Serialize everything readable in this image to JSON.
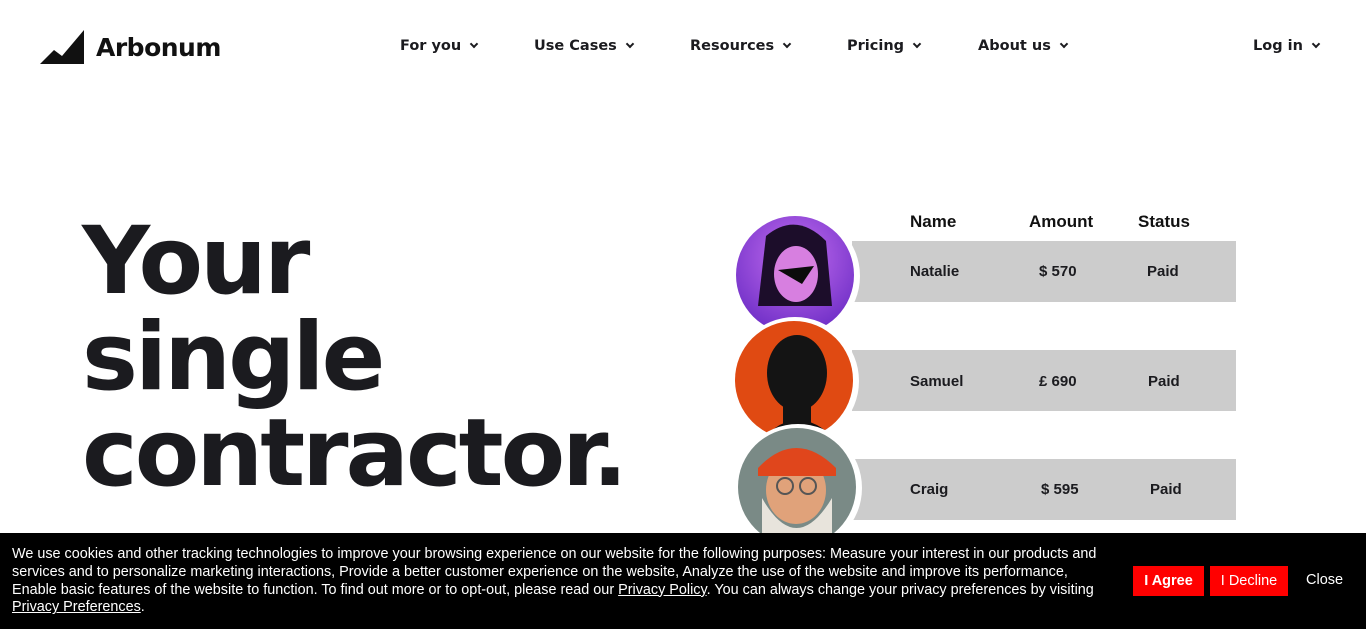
{
  "brand": {
    "name": "Arbonum",
    "logo_icon": "mountain-logo-icon"
  },
  "nav": {
    "items": [
      {
        "label": "For you",
        "icon": "chevron-down-icon"
      },
      {
        "label": "Use Cases",
        "icon": "chevron-down-icon"
      },
      {
        "label": "Resources",
        "icon": "chevron-down-icon"
      },
      {
        "label": "Pricing",
        "icon": "chevron-down-icon"
      },
      {
        "label": "About us",
        "icon": "chevron-down-icon"
      }
    ],
    "login": {
      "label": "Log in",
      "icon": "chevron-down-icon"
    }
  },
  "hero": {
    "line1": "Your",
    "line2": "single",
    "line3": "contractor."
  },
  "payments": {
    "headers": {
      "name": "Name",
      "amount": "Amount",
      "status": "Status"
    },
    "rows": [
      {
        "name": "Natalie",
        "amount": "$ 570",
        "status": "Paid",
        "avatar_color": "#8e44d8"
      },
      {
        "name": "Samuel",
        "amount": "£ 690",
        "status": "Paid",
        "avatar_color": "#e04a12"
      },
      {
        "name": "Craig",
        "amount": "$ 595",
        "status": "Paid",
        "avatar_color": "#e0a25a"
      }
    ]
  },
  "cookie": {
    "text_before": "We use cookies and other tracking technologies to improve your browsing experience on our website for the following purposes: Measure your interest in our products and services and to personalize marketing interactions, Provide a better customer experience on the website, Analyze the use of the website and improve its performance, Enable basic features of the website to function. To find out more or to opt-out, please read our ",
    "privacy_policy_link": "Privacy Policy",
    "text_middle": ". You can always change your privacy preferences by visiting ",
    "privacy_preferences_link": "Privacy Preferences",
    "text_after": ".",
    "agree_label": "I Agree",
    "decline_label": "I Decline",
    "close_label": "Close",
    "accent_color": "#ff0000"
  }
}
